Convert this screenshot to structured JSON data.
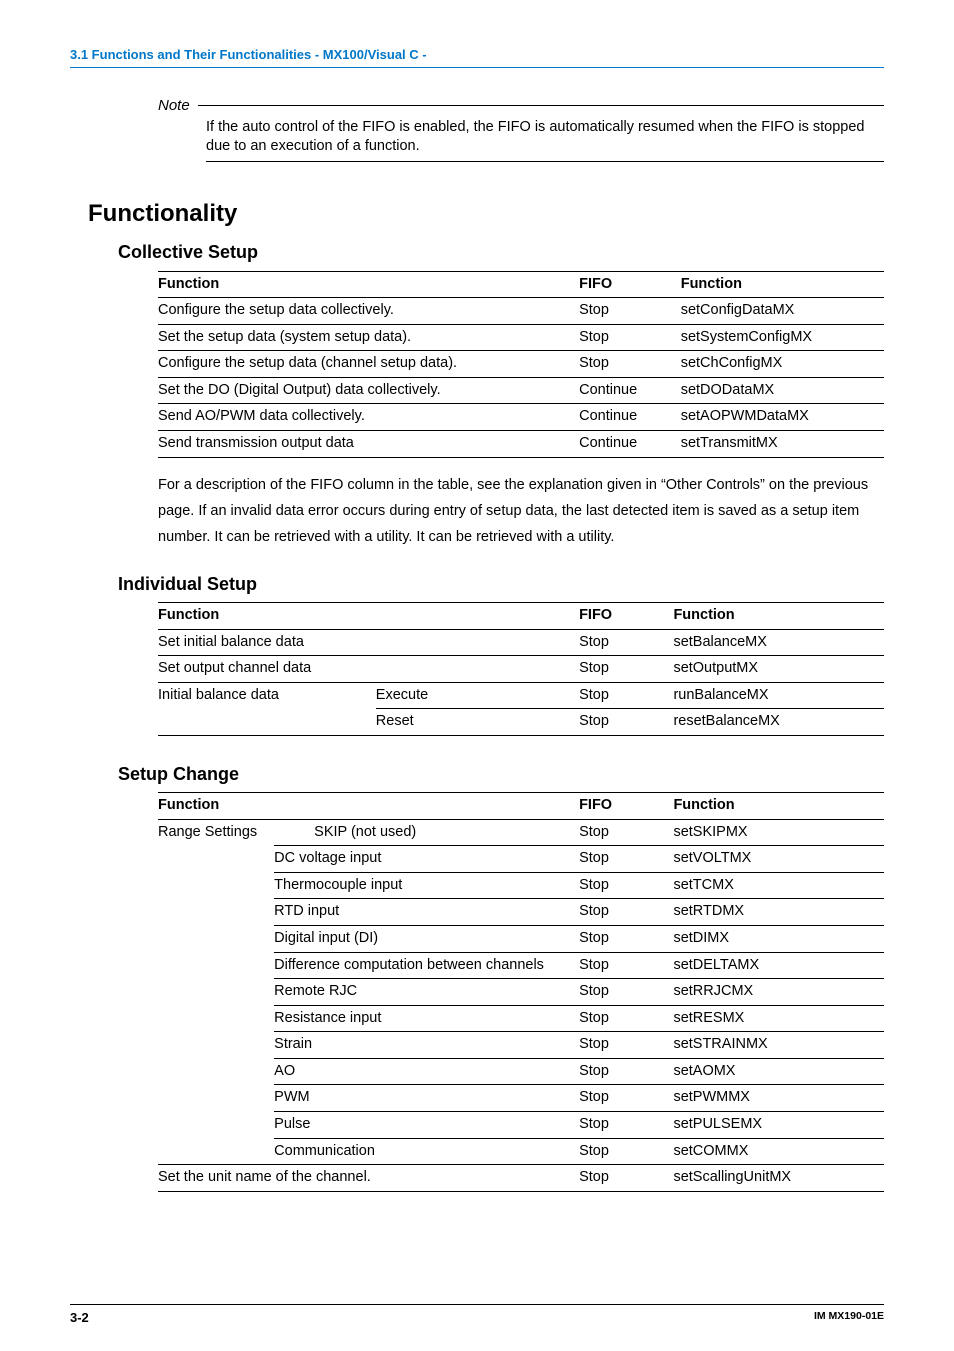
{
  "header": "3.1  Functions and Their Functionalities - MX100/Visual C -",
  "note": {
    "label": "Note",
    "body": "If the auto control of the FIFO is enabled, the FIFO is automatically resumed when the FIFO is stopped due to an execution of a function."
  },
  "h1": "Functionality",
  "collective": {
    "title": "Collective Setup",
    "headers": {
      "c1": "Function",
      "c2": "FIFO",
      "c3": "Function"
    },
    "rows": [
      {
        "c1": "Configure the setup data collectively.",
        "c2": "Stop",
        "c3": "setConfigDataMX"
      },
      {
        "c1": "Set the setup data (system setup data).",
        "c2": "Stop",
        "c3": "setSystemConfigMX"
      },
      {
        "c1": "Configure the setup data (channel setup data).",
        "c2": "Stop",
        "c3": "setChConfigMX"
      },
      {
        "c1": "Set the DO (Digital Output) data collectively.",
        "c2": "Continue",
        "c3": "setDODataMX"
      },
      {
        "c1": "Send AO/PWM data collectively.",
        "c2": "Continue",
        "c3": "setAOPWMDataMX"
      },
      {
        "c1": "Send transmission output data",
        "c2": "Continue",
        "c3": "setTransmitMX"
      }
    ],
    "para": "For a description of the FIFO column in the table, see the explanation given in “Other Controls” on the previous page. If an invalid data error occurs during entry of setup data, the last detected item is saved as a setup item number. It can be retrieved with a utility.  It can be retrieved with a utility."
  },
  "individual": {
    "title": "Individual Setup",
    "headers": {
      "c1": "Function",
      "c2": "",
      "c3": "FIFO",
      "c4": "Function"
    },
    "rows": [
      {
        "c1": "Set initial balance data",
        "c2": "",
        "c3": "Stop",
        "c4": "setBalanceMX"
      },
      {
        "c1": "Set output channel data",
        "c2": "",
        "c3": "Stop",
        "c4": "setOutputMX"
      },
      {
        "c1": "Initial balance data",
        "c2": "Execute",
        "c3": "Stop",
        "c4": "runBalanceMX"
      },
      {
        "c1": "",
        "c2": "Reset",
        "c3": "Stop",
        "c4": "resetBalanceMX",
        "noTopBorder": true
      }
    ]
  },
  "setup_change": {
    "title": "Setup Change",
    "headers": {
      "c1": "Function",
      "c2": "",
      "c3": "FIFO",
      "c4": "Function"
    },
    "rows": [
      {
        "c1": "Range Settings",
        "c2": "SKIP (not used)",
        "c3": "Stop",
        "c4": "setSKIPMX"
      },
      {
        "c1": "",
        "c2": "DC voltage input",
        "c3": "Stop",
        "c4": "setVOLTMX"
      },
      {
        "c1": "",
        "c2": "Thermocouple input",
        "c3": "Stop",
        "c4": "setTCMX"
      },
      {
        "c1": "",
        "c2": "RTD input",
        "c3": "Stop",
        "c4": "setRTDMX"
      },
      {
        "c1": "",
        "c2": "Digital input (DI)",
        "c3": "Stop",
        "c4": "setDIMX"
      },
      {
        "c1": "",
        "c2": "Difference computation between channels",
        "c3": "Stop",
        "c4": "setDELTAMX"
      },
      {
        "c1": "",
        "c2": "Remote RJC",
        "c3": "Stop",
        "c4": "setRRJCMX"
      },
      {
        "c1": "",
        "c2": "Resistance input",
        "c3": "Stop",
        "c4": "setRESMX"
      },
      {
        "c1": "",
        "c2": "Strain",
        "c3": "Stop",
        "c4": "setSTRAINMX"
      },
      {
        "c1": "",
        "c2": "AO",
        "c3": "Stop",
        "c4": "setAOMX"
      },
      {
        "c1": "",
        "c2": "PWM",
        "c3": "Stop",
        "c4": "setPWMMX"
      },
      {
        "c1": "",
        "c2": "Pulse",
        "c3": "Stop",
        "c4": "setPULSEMX"
      },
      {
        "c1": "",
        "c2": "Communication",
        "c3": "Stop",
        "c4": "setCOMMX"
      },
      {
        "c1": "Set the unit name of the channel.",
        "c2": "",
        "c3": "Stop",
        "c4": "setScallingUnitMX",
        "span": true
      }
    ]
  },
  "footer": {
    "page": "3-2",
    "doc": "IM MX190-01E"
  }
}
